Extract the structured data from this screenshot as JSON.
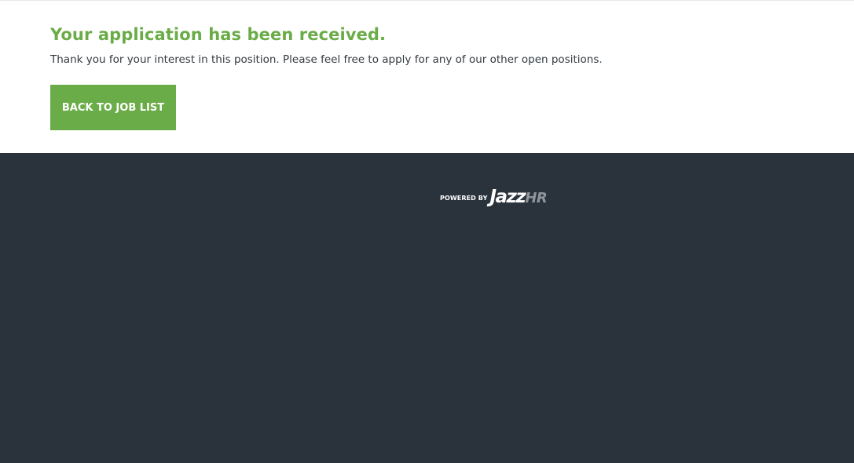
{
  "confirmation": {
    "title": "Your application has been received.",
    "message": "Thank you for your interest in this position. Please feel free to apply for any of our other open positions.",
    "back_button_label": "BACK TO JOB LIST"
  },
  "footer": {
    "powered_by": "POWERED BY",
    "brand_primary": "Jazz",
    "brand_secondary": "HR"
  },
  "colors": {
    "accent_green": "#6aac47",
    "footer_background": "#2a323b",
    "page_background": "#ffffff"
  }
}
